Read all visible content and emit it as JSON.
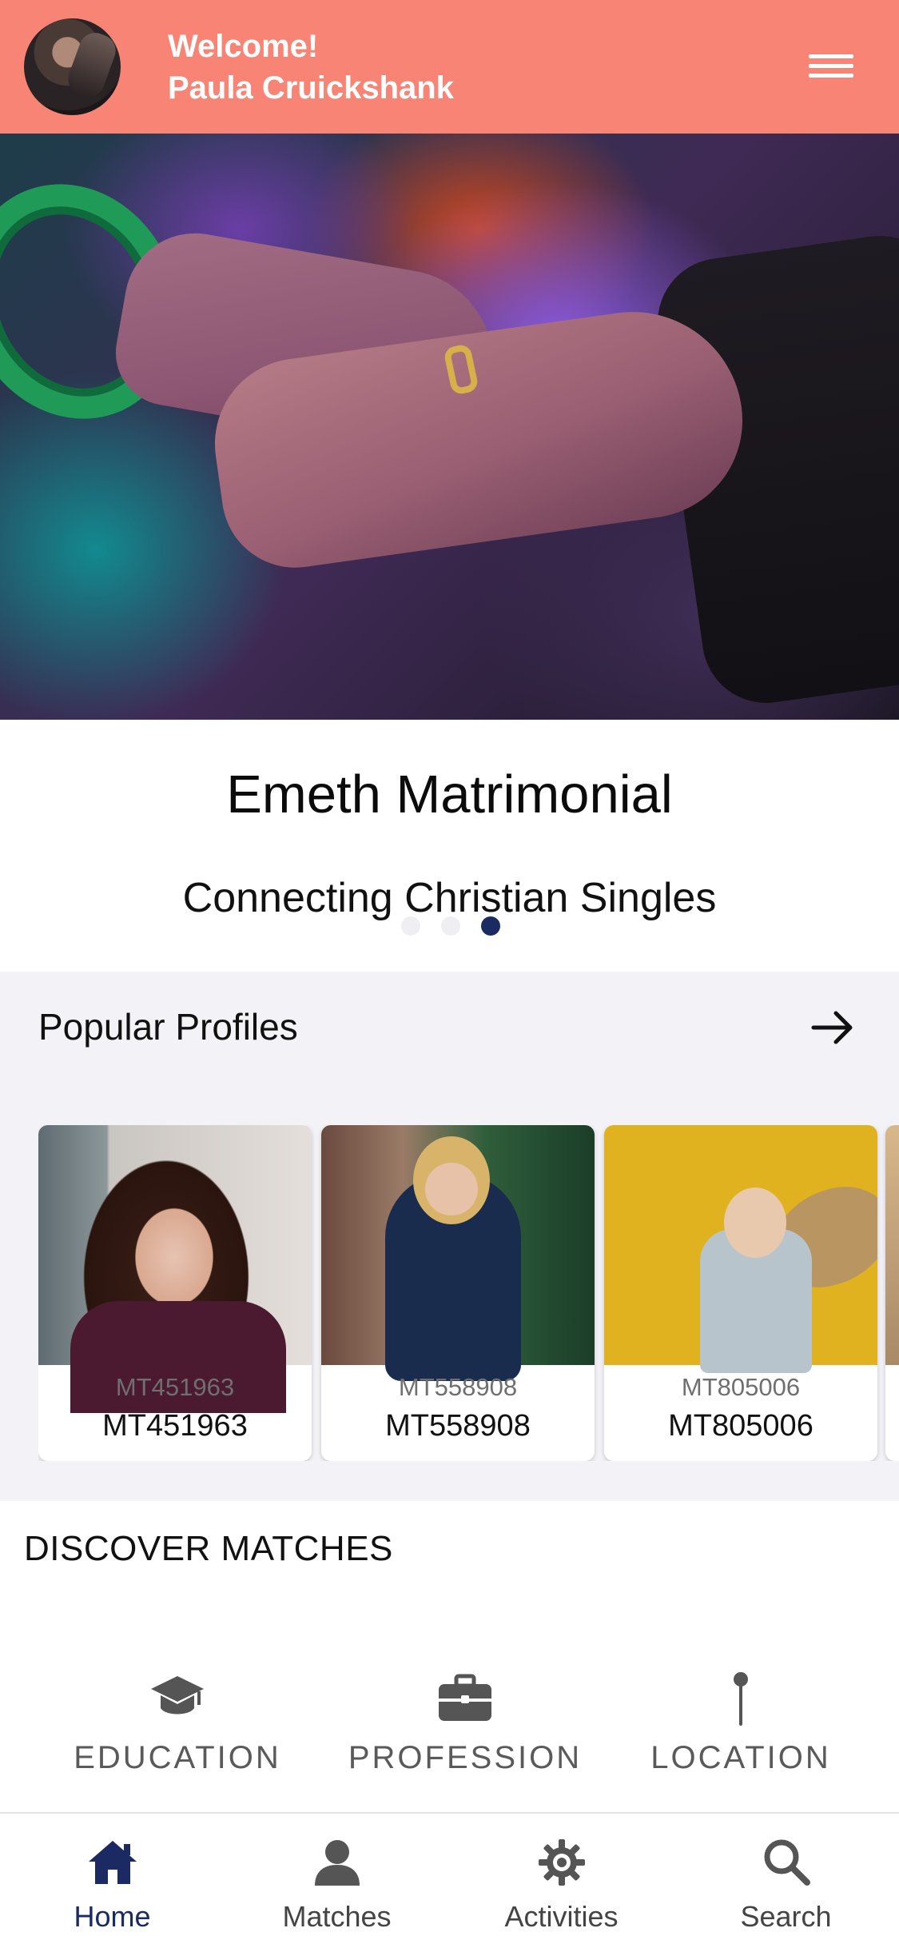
{
  "header": {
    "welcome_line1": "Welcome!",
    "welcome_line2": "Paula Cruickshank",
    "background_color": "#F78474"
  },
  "carousel": {
    "title": "Emeth Matrimonial",
    "subtitle": "Connecting Christian Singles",
    "page_count": 3,
    "active_index": 2
  },
  "popular": {
    "title": "Popular Profiles",
    "profiles": [
      {
        "id": "MT451963",
        "name": "MT451963"
      },
      {
        "id": "MT558908",
        "name": "MT558908"
      },
      {
        "id": "MT805006",
        "name": "MT805006"
      }
    ]
  },
  "discover": {
    "title": "DISCOVER MATCHES",
    "items": [
      {
        "label": "EDUCATION",
        "icon": "graduation-cap-icon"
      },
      {
        "label": "PROFESSION",
        "icon": "briefcase-icon"
      },
      {
        "label": "LOCATION",
        "icon": "map-pin-icon"
      }
    ]
  },
  "nav": {
    "active": "Home",
    "accent_color": "#1C2A63",
    "items": [
      {
        "label": "Home",
        "icon": "home-icon"
      },
      {
        "label": "Matches",
        "icon": "user-icon"
      },
      {
        "label": "Activities",
        "icon": "gear-icon"
      },
      {
        "label": "Search",
        "icon": "search-icon"
      }
    ]
  }
}
